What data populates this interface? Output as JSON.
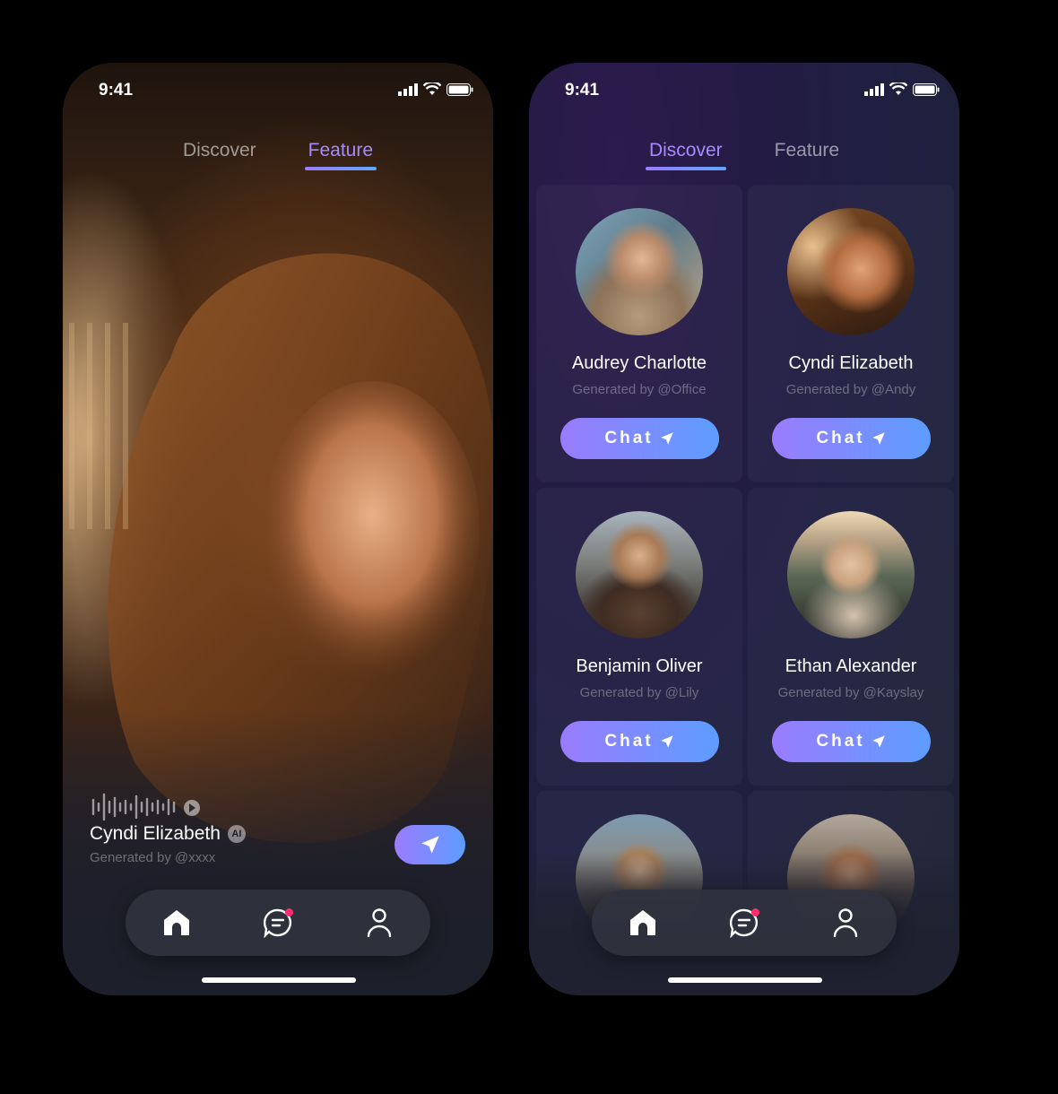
{
  "phones": {
    "left": {
      "status_time": "9:41",
      "tabs": [
        {
          "label": "Discover"
        },
        {
          "label": "Feature"
        }
      ],
      "profile": {
        "name": "Cyndi Elizabeth",
        "badge": "AI",
        "generated_by": "Generated by @xxxx"
      },
      "nav": [
        "home-icon",
        "chat-icon",
        "profile-icon"
      ]
    },
    "right": {
      "status_time": "9:41",
      "tabs": [
        {
          "label": "Discover"
        },
        {
          "label": "Feature"
        }
      ],
      "cards": [
        {
          "name": "Audrey Charlotte",
          "generated_by": "Generated by @Office",
          "button": "Chat"
        },
        {
          "name": "Cyndi Elizabeth",
          "generated_by": "Generated by @Andy",
          "button": "Chat"
        },
        {
          "name": "Benjamin Oliver",
          "generated_by": "Generated by @Lily",
          "button": "Chat"
        },
        {
          "name": "Ethan Alexander",
          "generated_by": "Generated by @Kayslay",
          "button": "Chat"
        }
      ],
      "nav": [
        "home-icon",
        "chat-icon",
        "profile-icon"
      ]
    }
  },
  "colors": {
    "accent_start": "#9a7cff",
    "accent_end": "#5d9dff",
    "notification": "#ff2d6f"
  }
}
